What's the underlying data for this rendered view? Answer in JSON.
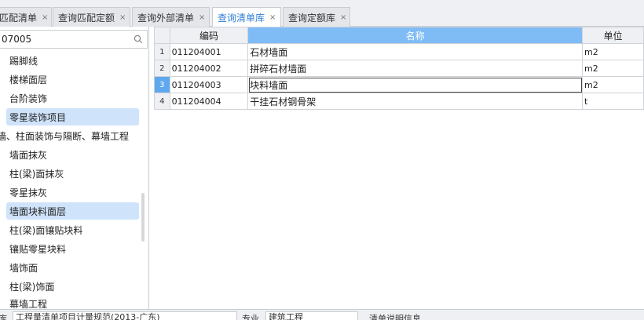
{
  "tabs": [
    {
      "label": "匹配清单",
      "active": false
    },
    {
      "label": "查询匹配定额",
      "active": false
    },
    {
      "label": "查询外部清单",
      "active": false
    },
    {
      "label": "查询清单库",
      "active": true
    },
    {
      "label": "查询定额库",
      "active": false
    }
  ],
  "tab_close_glyph": "×",
  "search": {
    "value": "07005",
    "icon": "search-icon"
  },
  "tree": {
    "items": [
      {
        "label": "踢脚线",
        "selected": false
      },
      {
        "label": "楼梯面层",
        "selected": false
      },
      {
        "label": "台阶装饰",
        "selected": false
      },
      {
        "label": "零星装饰项目",
        "selected": true
      },
      {
        "label": "墙、柱面装饰与隔断、幕墙工程",
        "selected": false
      },
      {
        "label": "墙面抹灰",
        "selected": false
      },
      {
        "label": "柱(梁)面抹灰",
        "selected": false
      },
      {
        "label": "零星抹灰",
        "selected": false
      },
      {
        "label": "墙面块料面层",
        "selected": true
      },
      {
        "label": "柱(梁)面镶贴块料",
        "selected": false
      },
      {
        "label": "镶贴零星块料",
        "selected": false
      },
      {
        "label": "墙饰面",
        "selected": false
      },
      {
        "label": "柱(梁)饰面",
        "selected": false
      },
      {
        "label": "幕墙工程",
        "selected": false
      }
    ]
  },
  "grid": {
    "columns": {
      "code": "编码",
      "name": "名称",
      "unit": "单位"
    },
    "rows": [
      {
        "num": "1",
        "code": "011204001",
        "name": "石材墙面",
        "unit": "m2"
      },
      {
        "num": "2",
        "code": "011204002",
        "name": "拼碎石材墙面",
        "unit": "m2"
      },
      {
        "num": "3",
        "code": "011204003",
        "name": "块料墙面",
        "unit": "m2"
      },
      {
        "num": "4",
        "code": "011204004",
        "name": "干挂石材钢骨架",
        "unit": "t"
      }
    ],
    "current_row": 3
  },
  "bottom": {
    "label1": "库",
    "library_value": "工程量清单项目计量规范(2013-广东)",
    "label2": "专业",
    "specialty_value": "建筑工程",
    "note": "清单说明信息"
  },
  "colors": {
    "accent": "#2f7fd1",
    "selected_tree": "#cfe3fb",
    "header_highlight": "#7fbcf6",
    "current_row": "#5ea8ee"
  }
}
